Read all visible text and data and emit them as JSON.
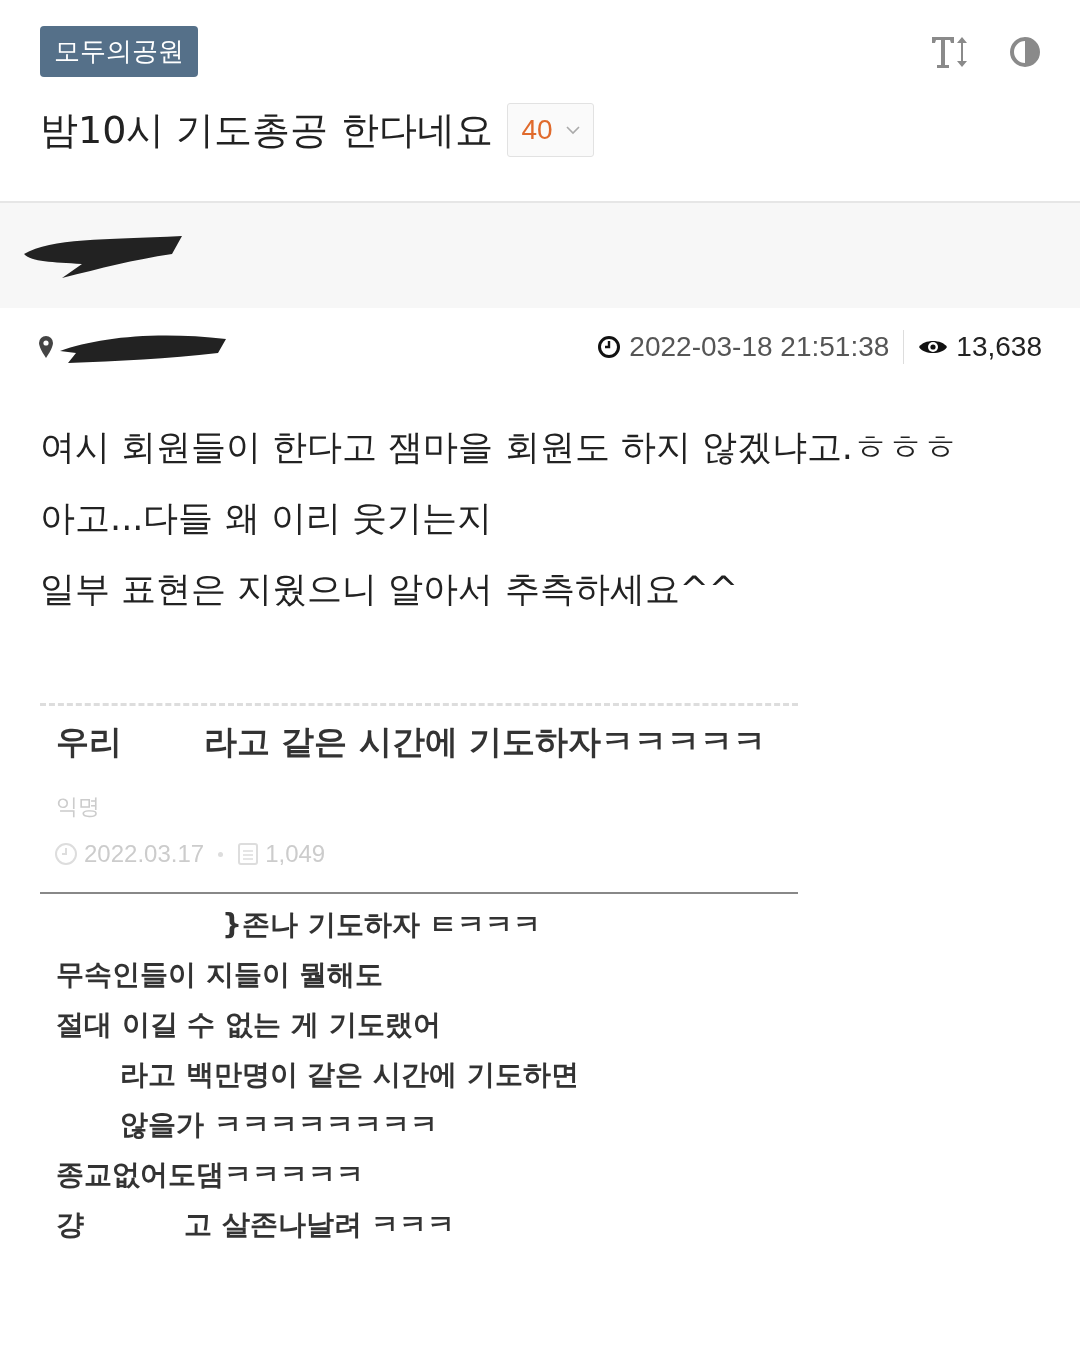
{
  "board": {
    "label": "모두의공원"
  },
  "post": {
    "title": "밤10시 기도총공 한다네요",
    "comment_count": "40",
    "date": "2022-03-18 21:51:38",
    "views": "13,638"
  },
  "body": [
    "여시 회원들이 한다고 잼마을 회원도 하지 않겠냐고.ㅎㅎㅎ",
    "아고...다들 왜 이리 웃기는지",
    "일부 표현은 지웠으니 알아서 추측하세요^^"
  ],
  "embedded": {
    "title_segments": [
      "우리",
      "라고 같은 시간에 기도하자ㅋㅋㅋㅋㅋ"
    ],
    "author": "익명",
    "date": "2022.03.17",
    "views": "1,049",
    "lines": [
      {
        "erased_lead": true,
        "segments": [
          "}존나 기도하자 ㅌㅋㅋㅋ"
        ]
      },
      {
        "erased_lead": false,
        "segments": [
          "무속인들이 지들이 뭘해도"
        ]
      },
      {
        "erased_lead": false,
        "segments": [
          "절대 이길 수 없는 게 기도랬어"
        ]
      },
      {
        "erased_lead": true,
        "segments": [
          "라고 백만명이 같은 시간에 기도하면"
        ]
      },
      {
        "erased_lead": true,
        "segments": [
          "않을가 ㅋㅋㅋㅋㅋㅋㅋㅋ"
        ]
      },
      {
        "erased_lead": false,
        "segments": [
          "종교없어도댐ㅋㅋㅋㅋㅋ"
        ]
      },
      {
        "erased_lead": false,
        "segments": [
          "걍",
          "고 살존나날려 ㅋㅋㅋ"
        ]
      }
    ]
  }
}
